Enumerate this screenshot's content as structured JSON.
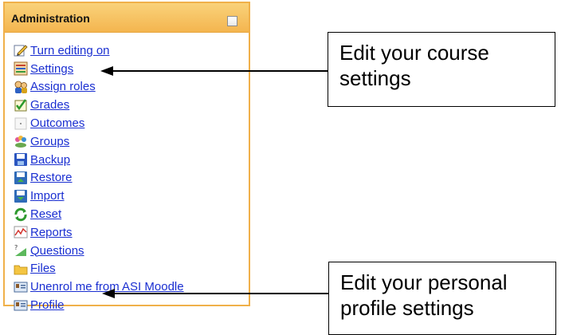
{
  "block": {
    "title": "Administration"
  },
  "menu": [
    {
      "label": "Turn editing on",
      "icon": "pencil-icon"
    },
    {
      "label": "Settings",
      "icon": "settings-icon"
    },
    {
      "label": "Assign roles",
      "icon": "roles-icon"
    },
    {
      "label": "Grades",
      "icon": "grades-icon"
    },
    {
      "label": "Outcomes",
      "icon": "outcomes-icon"
    },
    {
      "label": "Groups",
      "icon": "groups-icon"
    },
    {
      "label": "Backup",
      "icon": "backup-icon"
    },
    {
      "label": "Restore",
      "icon": "restore-icon"
    },
    {
      "label": "Import",
      "icon": "import-icon"
    },
    {
      "label": "Reset",
      "icon": "reset-icon"
    },
    {
      "label": "Reports",
      "icon": "reports-icon"
    },
    {
      "label": "Questions",
      "icon": "questions-icon"
    },
    {
      "label": "Files",
      "icon": "folder-icon"
    },
    {
      "label": "Unenrol me from ASI Moodle",
      "icon": "unenrol-icon"
    },
    {
      "label": "Profile",
      "icon": "profile-icon"
    }
  ],
  "callouts": {
    "course": "Edit your course settings",
    "profile": "Edit your personal profile settings"
  }
}
